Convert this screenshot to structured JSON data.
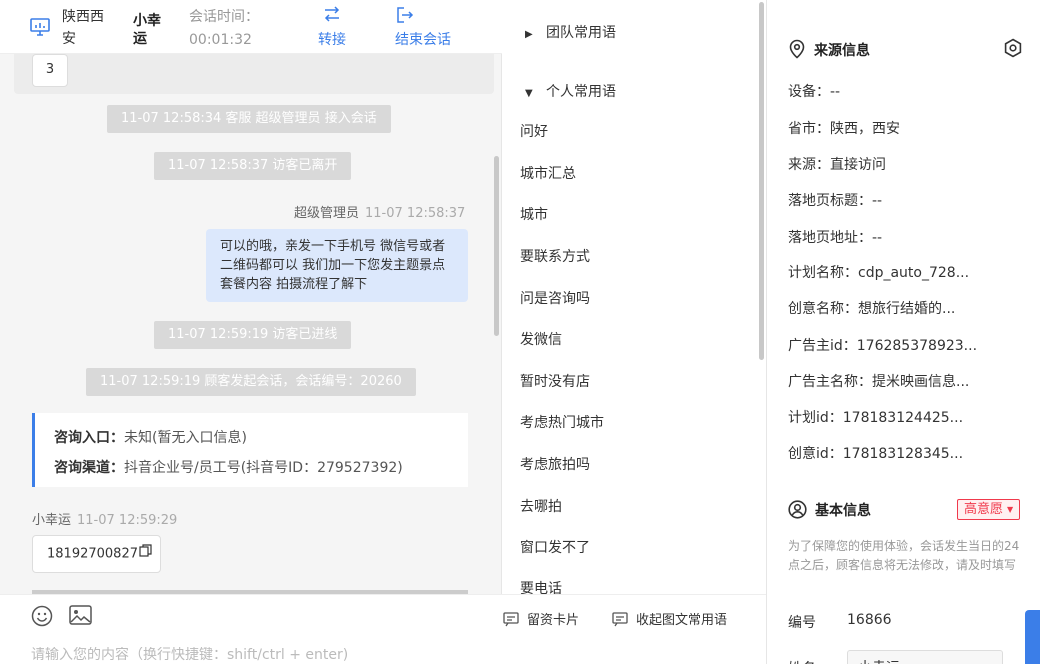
{
  "header": {
    "location": "陕西西安",
    "visitor_name": "小幸运",
    "session_time_label": "会话时间：",
    "session_time": "00:01:32",
    "transfer_label": "转接",
    "end_label": "结束会话"
  },
  "chat": {
    "page_chip": "3",
    "messages": [
      {
        "type": "system",
        "text": "11-07 12:58:34 客服 超级管理员 接入会话"
      },
      {
        "type": "system",
        "text": "11-07 12:58:37 访客已离开"
      },
      {
        "type": "agent_meta",
        "name": "超级管理员",
        "time": "11-07 12:58:37"
      },
      {
        "type": "agent_bubble",
        "text": "可以的哦，亲发一下手机号 微信号或者二维码都可以 我们加一下您发主题景点 套餐内容 拍摄流程了解下"
      },
      {
        "type": "system",
        "text": "11-07 12:59:19 访客已进线"
      },
      {
        "type": "system",
        "text": "11-07 12:59:19 顾客发起会话，会话编号：20260"
      },
      {
        "type": "visitor_meta",
        "name": "小幸运",
        "time": "11-07 12:59:29"
      },
      {
        "type": "visitor_chip",
        "text": "18192700827"
      }
    ],
    "info_card": {
      "entry_key": "咨询入口：",
      "entry_value": "未知(暂无入口信息)",
      "channel_key": "咨询渠道：",
      "channel_value": "抖音企业号/员工号(抖音号ID：279527392)"
    }
  },
  "composer": {
    "placeholder": "请输入您的内容（换行快捷键：shift/ctrl + enter)",
    "card_button": "留资卡片",
    "collapse_button": "收起图文常用语"
  },
  "phrases": {
    "team_group": "团队常用语",
    "personal_group": "个人常用语",
    "items": [
      "问好",
      "城市汇总",
      "城市",
      "要联系方式",
      "问是咨询吗",
      "发微信",
      "暂时没有店",
      "考虑热门城市",
      "考虑旅拍吗",
      "去哪拍",
      "窗口发不了",
      "要电话"
    ]
  },
  "source_info": {
    "title": "来源信息",
    "fields": [
      "设备：--",
      "省市：陕西，西安",
      "来源：直接访问",
      "落地页标题：--",
      "落地页地址：--",
      "计划名称：cdp_auto_728...",
      "创意名称：想旅行结婚的...",
      "广告主id：176285378923...",
      "广告主名称：提米映画信息...",
      "计划id：178183124425...",
      "创意id：178183128345..."
    ]
  },
  "basic_info": {
    "title": "基本信息",
    "intent_badge": "高意愿",
    "notice": "为了保障您的使用体验，会话发生当日的24点之后，顾客信息将无法修改，请及时填写",
    "id_label": "编号",
    "id_value": "16866",
    "name_label": "姓名",
    "name_value": "小幸运"
  },
  "colors": {
    "accent": "#3b7ee8",
    "bubble": "#dce8fc",
    "system_pill": "#d9d9d9",
    "badge": "#f0394c"
  }
}
